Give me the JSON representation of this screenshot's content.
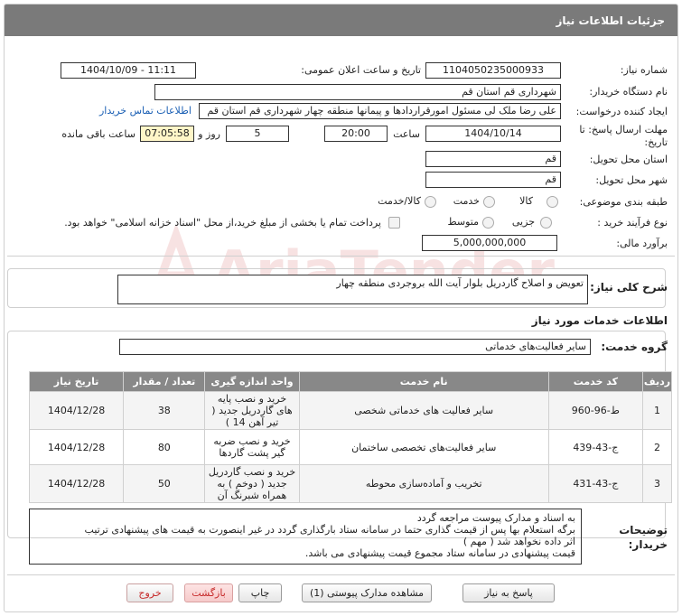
{
  "header": {
    "title": "جزئیات اطلاعات نیاز"
  },
  "form": {
    "need_number_label": "شماره نیاز:",
    "need_number": "1104050235000933",
    "announce_label": "تاریخ و ساعت اعلان عمومی:",
    "announce_value": "1404/10/09 - 11:11",
    "buyer_org_label": "نام دستگاه خریدار:",
    "buyer_org": "شهرداری قم استان قم",
    "requester_label": "ایجاد کننده درخواست:",
    "requester": "علی رضا ملک لی مسئول امورقراردادها و پیمانها منطقه چهار  شهرداری قم استان قم",
    "contact_link": "اطلاعات تماس خریدار",
    "deadline_label": "مهلت ارسال پاسخ: تا",
    "deadline_label2": "تاریخ:",
    "deadline_date": "1404/10/14",
    "time_label": "ساعت",
    "deadline_time": "20:00",
    "days_value": "5",
    "days_label": "روز و",
    "remaining_time": "07:05:58",
    "remaining_label": "ساعت باقی مانده",
    "province_label": "استان محل تحویل:",
    "province": "قم",
    "city_label": "شهر محل تحویل:",
    "city": "قم",
    "category_label": "طبقه بندی موضوعی:",
    "category_options": [
      "کالا",
      "خدمت",
      "کالا/خدمت"
    ],
    "process_label": "نوع فرآیند خرید :",
    "process_options": [
      "جزیی",
      "متوسط"
    ],
    "payment_note": "پرداخت تمام یا بخشی از مبلغ خرید،از محل \"اسناد خزانه اسلامی\" خواهد بود.",
    "estimate_label": "برآورد مالی:",
    "estimate": "5,000,000,000"
  },
  "summary": {
    "label": "شرح کلی نیاز:",
    "text": "تعویض و اصلاح گاردریل بلوار آیت الله بروجردی منطقه چهار"
  },
  "services": {
    "section_title": "اطلاعات خدمات مورد نیاز",
    "group_label": "گروه خدمت:",
    "group_value": "سایر فعالیت‌های خدماتی",
    "columns": [
      "ردیف",
      "کد خدمت",
      "نام خدمت",
      "واحد اندازه گیری",
      "تعداد / مقدار",
      "تاریخ نیاز"
    ],
    "rows": [
      {
        "row": "1",
        "code": "ط-96-960",
        "name": "سایر فعالیت های خدماتی شخصی",
        "unit": "خرید و نصب پایه های گاردریل جدید ( تیر آهن 14 )",
        "qty": "38",
        "date": "1404/12/28"
      },
      {
        "row": "2",
        "code": "ج-43-439",
        "name": "سایر فعالیت‌های تخصصی ساختمان",
        "unit": "خرید و نصب ضربه گیر پشت گاردها",
        "qty": "80",
        "date": "1404/12/28"
      },
      {
        "row": "3",
        "code": "ج-43-431",
        "name": "تخریب و آماده‌سازی محوطه",
        "unit": "خرید و نصب گاردریل جدید ( دوخم ) به همراه شبرنگ آن",
        "qty": "50",
        "date": "1404/12/28"
      }
    ]
  },
  "buyer_notes": {
    "label": "توضیحات",
    "label2": "خریدار:",
    "lines": [
      "به اسناد و مدارک پیوست مراجعه گردد",
      "برگه استعلام بها  پس از قیمت گذاری حتما در سامانه ستاد بارگذاری گردد در غیر اینصورت به قیمت های پیشنهادی  ترتیب",
      "اثر داده نخواهد شد ( مهم )",
      "قیمت پیشنهادی در سامانه ستاد مجموع قیمت پیشنهادی می باشد."
    ]
  },
  "buttons": {
    "reply": "پاسخ به نیاز",
    "view_docs": "مشاهده مدارک پیوستی (1)",
    "print": "چاپ",
    "back": "بازگشت",
    "exit": "خروج"
  }
}
